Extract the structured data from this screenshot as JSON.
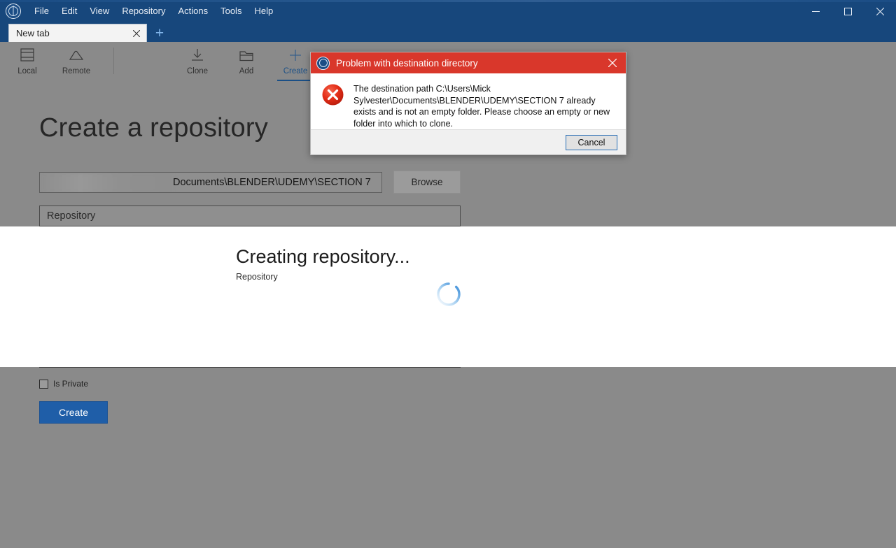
{
  "window": {
    "app_logo_icon": "app-logo-icon",
    "menu": [
      "File",
      "Edit",
      "View",
      "Repository",
      "Actions",
      "Tools",
      "Help"
    ],
    "controls": {
      "minimize": "minimize-icon",
      "maximize": "maximize-icon",
      "close": "close-icon"
    }
  },
  "tabs": {
    "items": [
      {
        "label": "New tab",
        "close_icon": "close-icon"
      }
    ],
    "new_tab_icon": "plus-icon"
  },
  "toolbar": {
    "items": [
      {
        "label": "Local",
        "icon": "local-repository-icon",
        "active": false
      },
      {
        "label": "Remote",
        "icon": "cloud-icon",
        "active": false
      },
      {
        "label": "Clone",
        "icon": "clone-download-icon",
        "active": false
      },
      {
        "label": "Add",
        "icon": "folder-add-icon",
        "active": false
      },
      {
        "label": "Create",
        "icon": "plus-icon",
        "active": true
      }
    ]
  },
  "main": {
    "page_title": "Create a repository",
    "path_field": {
      "value": "Documents\\BLENDER\\UDEMY\\SECTION 7",
      "redacted_prefix": true
    },
    "browse_label": "Browse",
    "repository_field": {
      "placeholder": "Repository",
      "value": ""
    },
    "is_private": {
      "label": "Is Private",
      "checked": false
    },
    "create_label": "Create"
  },
  "progress": {
    "title": "Creating repository...",
    "subtitle": "Repository",
    "spinner_icon": "loading-spinner-icon",
    "spinner_color": "#2f86d6"
  },
  "dialog": {
    "title": "Problem with destination directory",
    "title_icon": "app-logo-icon",
    "close_icon": "close-icon",
    "error_icon": "error-circle-icon",
    "message": "The destination path C:\\Users\\Mick Sylvester\\Documents\\BLENDER\\UDEMY\\SECTION 7 already exists and is not an empty folder. Please choose an empty or new folder into which to clone.",
    "cancel_label": "Cancel",
    "header_color": "#d9372b",
    "error_color": "#e02b1a"
  }
}
